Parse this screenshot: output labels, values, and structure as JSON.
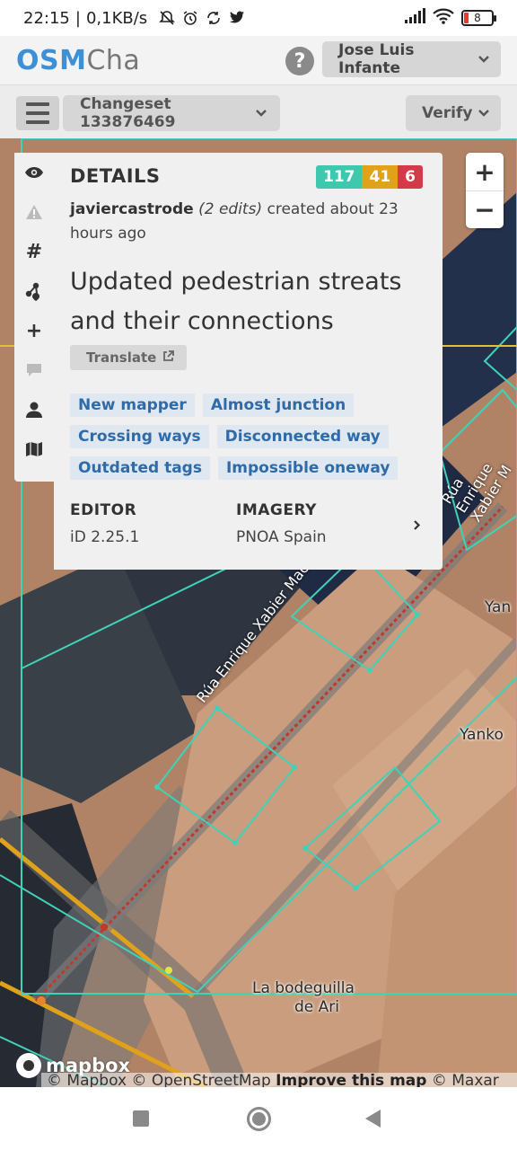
{
  "status": {
    "time": "22:15",
    "net_speed": "0,1KB/s",
    "battery": "8",
    "icons": [
      "bell-off-icon",
      "alarm-icon",
      "sync-icon",
      "twitter-icon",
      "signal-icon",
      "wifi-icon",
      "battery-icon"
    ]
  },
  "header": {
    "logo_bold": "OSM",
    "logo_light": "Cha",
    "help_label": "?",
    "user": "Jose Luis Infante"
  },
  "toolbar": {
    "changeset": "Changeset 133876469",
    "verify": "Verify"
  },
  "details": {
    "title": "DETAILS",
    "counts": {
      "created": "117",
      "modified": "41",
      "deleted": "6"
    },
    "user": "javiercastrode",
    "edits": "(2 edits)",
    "created_text": "created about 23 hours ago",
    "comment": "Updated pedestrian streats and their connections",
    "translate": "Translate",
    "tags": [
      "New mapper",
      "Almost junction",
      "Crossing ways",
      "Disconnected way",
      "Outdated tags",
      "Impossible oneway"
    ],
    "editor_label": "EDITOR",
    "editor_value": "iD 2.25.1",
    "imagery_label": "IMAGERY",
    "imagery_value": "PNOA Spain"
  },
  "map": {
    "street_1": "Rúa Enrique Xabier Macías",
    "street_2": "Rúa Enrique Xabier M",
    "poi_1": "Yanko",
    "poi_2": "La bodeguilla",
    "poi_2b": "de Ari",
    "poi_3": "Yan",
    "zoom_in": "+",
    "zoom_out": "−",
    "mapbox": "mapbox",
    "attribution_1": "© Mapbox © OpenStreetMap ",
    "attribution_2": "Improve this map",
    "attribution_3": " © Maxar"
  }
}
